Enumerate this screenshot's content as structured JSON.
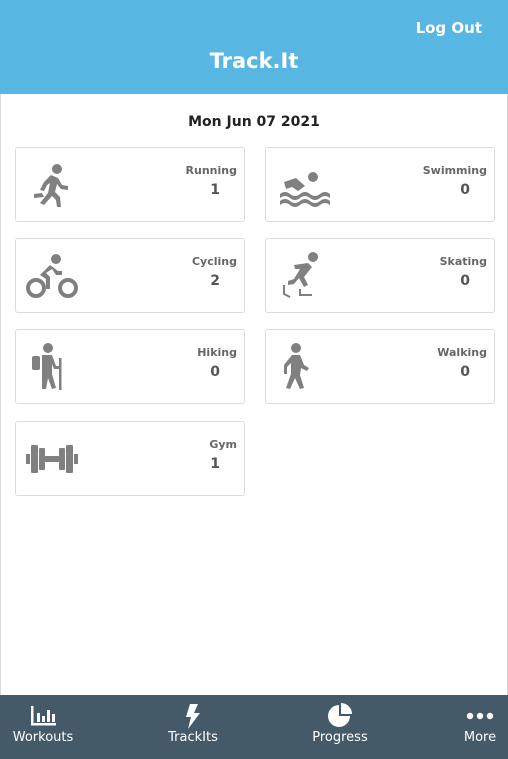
{
  "header": {
    "title": "Track.It",
    "logout_label": "Log Out",
    "background": "#58b6e3"
  },
  "date": "Mon Jun 07 2021",
  "activities": [
    {
      "label": "Running",
      "count": "1",
      "icon": "running-icon"
    },
    {
      "label": "Swimming",
      "count": "0",
      "icon": "swimming-icon"
    },
    {
      "label": "Cycling",
      "count": "2",
      "icon": "cycling-icon"
    },
    {
      "label": "Skating",
      "count": "0",
      "icon": "skating-icon"
    },
    {
      "label": "Hiking",
      "count": "0",
      "icon": "hiking-icon"
    },
    {
      "label": "Walking",
      "count": "0",
      "icon": "walking-icon"
    },
    {
      "label": "Gym",
      "count": "1",
      "icon": "dumbbell-icon"
    }
  ],
  "nav": {
    "background": "#455a68",
    "items": [
      {
        "label": "Workouts",
        "icon": "bar-chart-icon"
      },
      {
        "label": "TrackIts",
        "icon": "lightning-icon"
      },
      {
        "label": "Progress",
        "icon": "pie-chart-icon"
      },
      {
        "label": "More",
        "icon": "more-dots-icon"
      }
    ]
  },
  "colors": {
    "icon_gray": "#808080",
    "card_border": "#dcdcdc"
  }
}
